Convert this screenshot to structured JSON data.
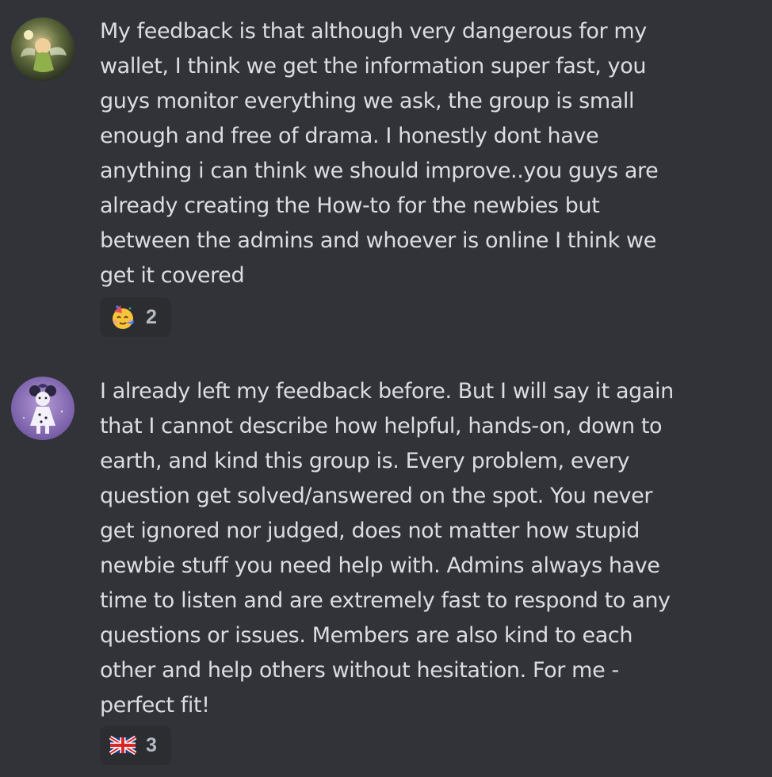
{
  "messages": [
    {
      "avatar": {
        "icon": "fairy-avatar",
        "bg": "#3a4a2a"
      },
      "text": "My feedback is that although very dangerous for my\nwallet, I think we get the information super fast, you\nguys monitor everything we ask, the group is small\nenough and free of drama. I honestly dont have\nanything i can think we should improve..you guys are\nalready creating the How-to for the newbies but\nbetween the admins and whoever is online I think we\nget it covered",
      "reaction": {
        "icon": "partying-face-emoji",
        "count": "2"
      }
    },
    {
      "avatar": {
        "icon": "minnie-figure-avatar",
        "bg": "#8a6fb0"
      },
      "text": "I already left my feedback before. But I will say it again\nthat I cannot describe how helpful, hands-on, down to\nearth, and kind this group is. Every problem, every\nquestion get solved/answered on the spot. You never\nget ignored nor judged, does not matter how stupid\nnewbie stuff you need help with. Admins always have\ntime to listen and are extremely fast to respond to any\nquestions or issues. Members are also kind to each\nother and help others without hesitation. For me -\nperfect fit!",
      "reaction": {
        "icon": "uk-flag-emoji",
        "count": "3"
      }
    }
  ],
  "colors": {
    "background": "#313338",
    "text": "#dbdee1",
    "reaction_bg": "#2b2d31",
    "reaction_count": "#b5bac1"
  }
}
